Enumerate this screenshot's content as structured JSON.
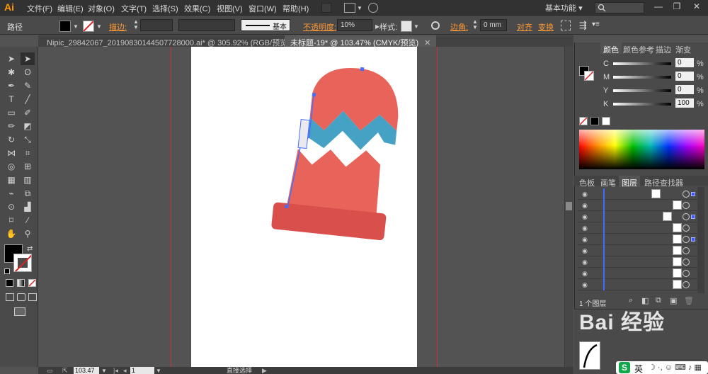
{
  "app": {
    "logo": "Ai"
  },
  "menu": [
    "文件(F)",
    "编辑(E)",
    "对象(O)",
    "文字(T)",
    "选择(S)",
    "效果(C)",
    "视图(V)",
    "窗口(W)",
    "帮助(H)"
  ],
  "workspace": {
    "label": "基本功能",
    "arrow": "▾"
  },
  "window_controls": [
    "—",
    "❐",
    "✕"
  ],
  "control_bar": {
    "selection_label": "路径",
    "stroke_label": "描边:",
    "stroke_style_label": "基本",
    "opacity_label": "不透明度:",
    "opacity_value": "10%",
    "style_label": "样式:",
    "corner_label": "边角:",
    "corner_value": "0 mm",
    "align_label": "对齐",
    "transform_label": "变换"
  },
  "tabs": [
    {
      "label": "Nipic_29842067_20190830144507728000.ai* @ 305.92% (RGB/预览)",
      "close": "✕",
      "active": false
    },
    {
      "label": "未标题-19* @ 103.47% (CMYK/预览)",
      "close": "✕",
      "active": true
    }
  ],
  "color_panel": {
    "tabs": [
      "颜色",
      "颜色参考",
      "描边",
      "渐变"
    ],
    "channels": [
      {
        "name": "C",
        "value": "0",
        "unit": "%"
      },
      {
        "name": "M",
        "value": "0",
        "unit": "%"
      },
      {
        "name": "Y",
        "value": "0",
        "unit": "%"
      },
      {
        "name": "K",
        "value": "100",
        "unit": "%"
      }
    ]
  },
  "layers_panel": {
    "tabs": [
      "色板",
      "画笔",
      "图层",
      "路径查找器"
    ],
    "footer_label": "1 个图层",
    "rows": 9
  },
  "status": {
    "zoom": "103.47",
    "page": "1",
    "tool": "直接选择"
  },
  "watermark": {
    "text": "Bai 经验"
  },
  "ime": {
    "text": "英"
  },
  "colors": {
    "hat_red": "#e8645a",
    "hat_cuff": "#d94f4c",
    "hat_blue": "#45a2c4",
    "selection": "#4a6cff",
    "guide": "#c23b3b"
  }
}
